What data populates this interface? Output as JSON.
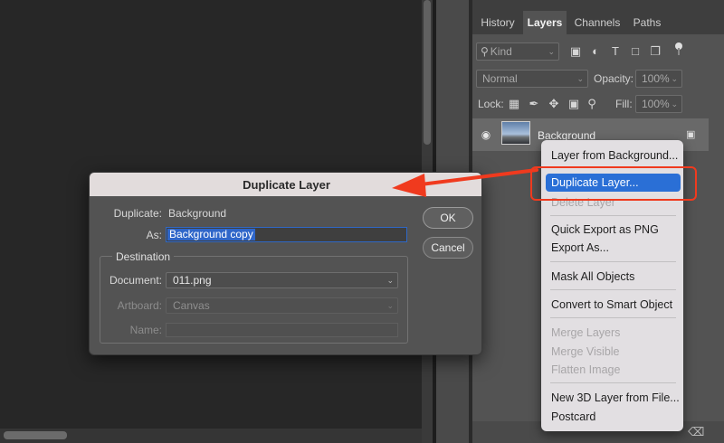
{
  "panel": {
    "tabs": [
      "History",
      "Layers",
      "Channels",
      "Paths"
    ],
    "active_tab": "Layers",
    "filter_kind": "Kind",
    "blend_mode": "Normal",
    "opacity_label": "Opacity:",
    "opacity_value": "100%",
    "lock_label": "Lock:",
    "fill_label": "Fill:",
    "fill_value": "100%",
    "layer_name": "Background"
  },
  "context_menu": {
    "items": [
      {
        "label": "Layer from Background...",
        "enabled": true
      },
      {
        "label": "Duplicate Layer...",
        "enabled": true,
        "highlighted": true
      },
      {
        "label": "Delete Layer",
        "enabled": false
      },
      {
        "label": "Quick Export as PNG",
        "enabled": true
      },
      {
        "label": "Export As...",
        "enabled": true
      },
      {
        "label": "Mask All Objects",
        "enabled": true
      },
      {
        "label": "Convert to Smart Object",
        "enabled": true
      },
      {
        "label": "Merge Layers",
        "enabled": false
      },
      {
        "label": "Merge Visible",
        "enabled": false
      },
      {
        "label": "Flatten Image",
        "enabled": false
      },
      {
        "label": "New 3D Layer from File...",
        "enabled": true
      },
      {
        "label": "Postcard",
        "enabled": true
      }
    ]
  },
  "dialog": {
    "title": "Duplicate Layer",
    "duplicate_label": "Duplicate:",
    "duplicate_value": "Background",
    "as_label": "As:",
    "as_value": "Background copy",
    "destination_label": "Destination",
    "document_label": "Document:",
    "document_value": "011.png",
    "artboard_label": "Artboard:",
    "artboard_value": "Canvas",
    "name_label": "Name:",
    "name_value": "",
    "ok_label": "OK",
    "cancel_label": "Cancel"
  },
  "colors": {
    "annotation": "#f03a1e",
    "menu_highlight": "#2a6fd6",
    "text_selection": "#2f66c9"
  }
}
